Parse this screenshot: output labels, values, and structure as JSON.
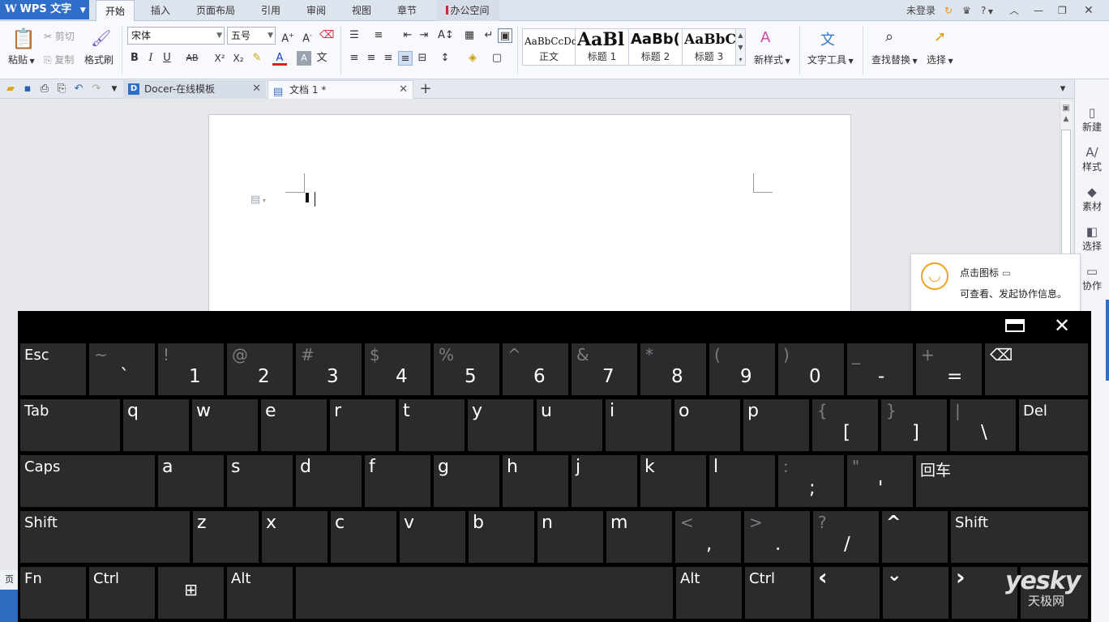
{
  "app": {
    "title": "WPS 文字",
    "logo_letter": "W"
  },
  "menu": {
    "tabs": [
      "开始",
      "插入",
      "页面布局",
      "引用",
      "审阅",
      "视图",
      "章节",
      "办公空间"
    ],
    "login": "未登录",
    "help": "?"
  },
  "ribbon": {
    "paste": "粘贴",
    "cut": "剪切",
    "copy": "复制",
    "format_painter": "格式刷",
    "font_name": "宋体",
    "font_size": "五号",
    "bold": "B",
    "italic": "I",
    "underline": "U",
    "strike": "AB",
    "superscript": "X²",
    "subscript": "X₂",
    "font_color": "A",
    "char_shade": "A",
    "styles": [
      {
        "sample": "AaBbCcDd",
        "name": "正文"
      },
      {
        "sample": "AaBl",
        "name": "标题 1"
      },
      {
        "sample": "AaBb(",
        "name": "标题 2"
      },
      {
        "sample": "AaBbC",
        "name": "标题 3"
      }
    ],
    "new_style": "新样式",
    "text_tools": "文字工具",
    "find_replace": "查找替换",
    "select": "选择"
  },
  "tabs": [
    {
      "label": "Docer-在线模板"
    },
    {
      "label": "文档 1 *"
    }
  ],
  "sidepanel": {
    "items": [
      "新建",
      "样式",
      "素材",
      "选择",
      "协作"
    ]
  },
  "balloon": {
    "title": "点击图标",
    "body": "可查看、发起协作信息。"
  },
  "status": {
    "page_label": "页"
  },
  "keyboard": {
    "row1": [
      {
        "main": "Esc"
      },
      {
        "top": "~",
        "bot": "`"
      },
      {
        "top": "!",
        "bot": "1"
      },
      {
        "top": "@",
        "bot": "2"
      },
      {
        "top": "#",
        "bot": "3"
      },
      {
        "top": "$",
        "bot": "4"
      },
      {
        "top": "%",
        "bot": "5"
      },
      {
        "top": "^",
        "bot": "6"
      },
      {
        "top": "&",
        "bot": "7"
      },
      {
        "top": "*",
        "bot": "8"
      },
      {
        "top": "(",
        "bot": "9"
      },
      {
        "top": ")",
        "bot": "0"
      },
      {
        "top": "_",
        "bot": "-"
      },
      {
        "top": "+",
        "bot": "="
      }
    ],
    "row2": [
      {
        "main": "Tab"
      },
      {
        "main": "q"
      },
      {
        "main": "w"
      },
      {
        "main": "e"
      },
      {
        "main": "r"
      },
      {
        "main": "t"
      },
      {
        "main": "y"
      },
      {
        "main": "u"
      },
      {
        "main": "i"
      },
      {
        "main": "o"
      },
      {
        "main": "p"
      },
      {
        "top": "{",
        "bot": "["
      },
      {
        "top": "}",
        "bot": "]"
      },
      {
        "top": "|",
        "bot": "\\"
      },
      {
        "main": "Del"
      }
    ],
    "row3": [
      {
        "main": "Caps"
      },
      {
        "main": "a"
      },
      {
        "main": "s"
      },
      {
        "main": "d"
      },
      {
        "main": "f"
      },
      {
        "main": "g"
      },
      {
        "main": "h"
      },
      {
        "main": "j"
      },
      {
        "main": "k"
      },
      {
        "main": "l"
      },
      {
        "top": ":",
        "bot": ";"
      },
      {
        "top": "\"",
        "bot": "'"
      },
      {
        "main": "回车"
      }
    ],
    "row4": [
      {
        "main": "Shift"
      },
      {
        "main": "z"
      },
      {
        "main": "x"
      },
      {
        "main": "c"
      },
      {
        "main": "v"
      },
      {
        "main": "b"
      },
      {
        "main": "n"
      },
      {
        "main": "m"
      },
      {
        "top": "<",
        "bot": ","
      },
      {
        "top": ">",
        "bot": "."
      },
      {
        "top": "?",
        "bot": "/"
      },
      {
        "main": "^"
      },
      {
        "main": "Shift"
      }
    ],
    "row5": [
      {
        "main": "Fn"
      },
      {
        "main": "Ctrl"
      },
      {
        "main": "⊞"
      },
      {
        "main": "Alt"
      },
      {
        "main": ""
      },
      {
        "main": "Alt"
      },
      {
        "main": "Ctrl"
      },
      {
        "main": "‹"
      },
      {
        "main": "⌄"
      },
      {
        "main": "›"
      }
    ]
  },
  "watermark": {
    "brand": "yesky",
    "sub": "天极网"
  }
}
